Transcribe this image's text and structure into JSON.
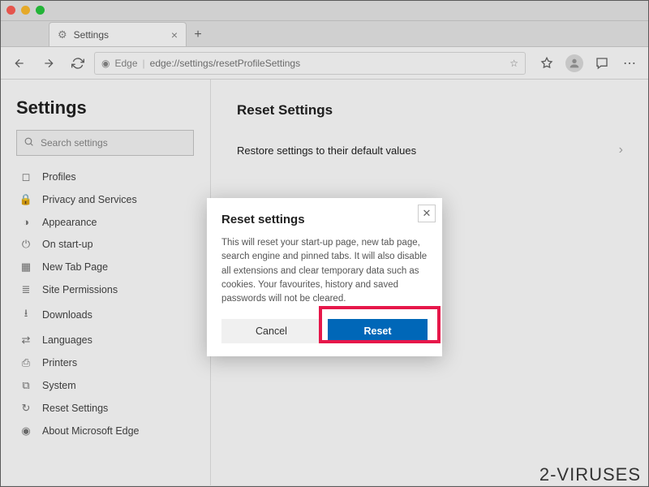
{
  "titlebar": {},
  "tab": {
    "title": "Settings"
  },
  "addressbar": {
    "product": "Edge",
    "url": "edge://settings/resetProfileSettings"
  },
  "sidebar": {
    "heading": "Settings",
    "search_placeholder": "Search settings",
    "items": [
      {
        "icon": "profile-icon",
        "label": "Profiles"
      },
      {
        "icon": "lock-icon",
        "label": "Privacy and Services"
      },
      {
        "icon": "appearance-icon",
        "label": "Appearance"
      },
      {
        "icon": "power-icon",
        "label": "On start-up"
      },
      {
        "icon": "newtab-icon",
        "label": "New Tab Page"
      },
      {
        "icon": "permissions-icon",
        "label": "Site Permissions"
      },
      {
        "icon": "download-icon",
        "label": "Downloads"
      },
      {
        "icon": "languages-icon",
        "label": "Languages"
      },
      {
        "icon": "printer-icon",
        "label": "Printers"
      },
      {
        "icon": "system-icon",
        "label": "System"
      },
      {
        "icon": "reset-icon",
        "label": "Reset Settings"
      },
      {
        "icon": "edge-icon",
        "label": "About Microsoft Edge"
      }
    ]
  },
  "main": {
    "heading": "Reset Settings",
    "row_label": "Restore settings to their default values"
  },
  "modal": {
    "title": "Reset settings",
    "body": "This will reset your start-up page, new tab page, search engine and pinned tabs. It will also disable all extensions and clear temporary data such as cookies. Your favourites, history and saved passwords will not be cleared.",
    "cancel": "Cancel",
    "reset": "Reset"
  },
  "watermark": "2-VIRUSES"
}
